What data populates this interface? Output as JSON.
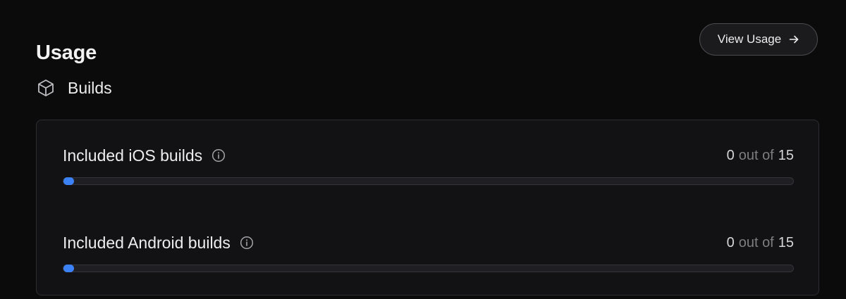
{
  "header": {
    "title": "Usage",
    "view_usage_label": "View Usage",
    "view_usage_icon": "arrow-right-icon"
  },
  "section": {
    "title": "Builds",
    "icon": "cube-icon"
  },
  "usage_items": [
    {
      "label": "Included iOS builds",
      "used": "0",
      "separator": "out of",
      "limit": "15",
      "progress_fraction": 0,
      "info_icon": "info-icon"
    },
    {
      "label": "Included Android builds",
      "used": "0",
      "separator": "out of",
      "limit": "15",
      "progress_fraction": 0,
      "info_icon": "info-icon"
    }
  ],
  "colors": {
    "background": "#0b0b0c",
    "card": "#121214",
    "accent": "#3b82f6",
    "text": "#ededee",
    "muted": "#7d7d82"
  }
}
